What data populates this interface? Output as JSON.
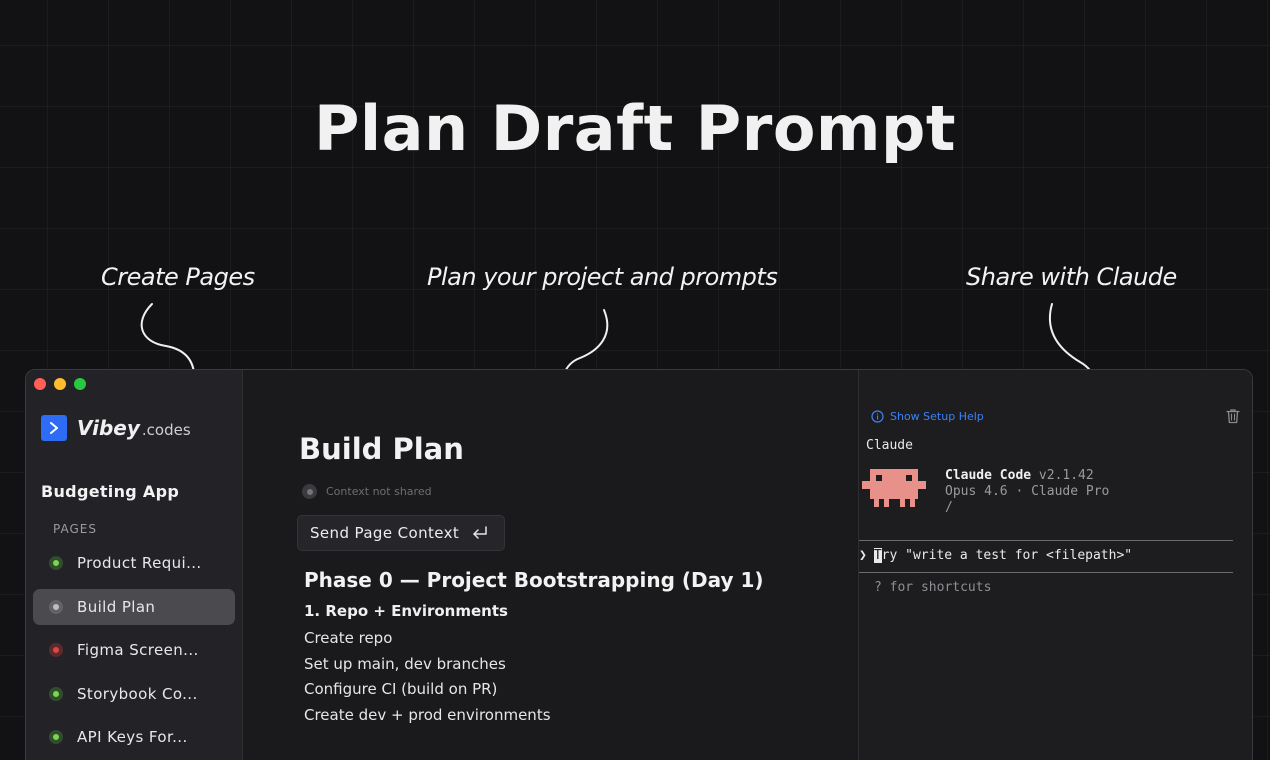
{
  "headline": "Plan Draft Prompt",
  "annotations": {
    "left": "Create Pages",
    "center": "Plan your project and prompts",
    "right": "Share with Claude"
  },
  "colors": {
    "accent_blue": "#2f6cf6",
    "link_blue": "#3b82f6",
    "status_green": "#7cd64a",
    "status_red": "#e04545",
    "status_gray": "#bdbdbd",
    "mascot": "#e8908a"
  },
  "sidebar": {
    "logo_name": "Vibey",
    "logo_suffix": ".codes",
    "project_title": "Budgeting App",
    "pages_label": "PAGES",
    "items": [
      {
        "label": "Product Requi...",
        "status": "green",
        "active": false
      },
      {
        "label": "Build Plan",
        "status": "gray",
        "active": true
      },
      {
        "label": "Figma Screen...",
        "status": "red",
        "active": false
      },
      {
        "label": "Storybook Co...",
        "status": "green",
        "active": false
      },
      {
        "label": "API Keys For...",
        "status": "green",
        "active": false
      }
    ]
  },
  "main": {
    "title": "Build Plan",
    "context_status": "Context not shared",
    "send_button": "Send Page Context",
    "phase_title": "Phase 0 — Project Bootstrapping (Day 1)",
    "section_title": "1. Repo + Environments",
    "tasks": [
      "Create repo",
      "Set up main, dev branches",
      "Configure CI (build on PR)",
      "Create dev + prod environments"
    ]
  },
  "terminal": {
    "setup_help": "Show Setup Help",
    "label": "Claude",
    "app_name": "Claude Code",
    "version": "v2.1.42",
    "model_line": "Opus 4.6 · Claude Pro",
    "path": "/",
    "prompt_symbol": "❯",
    "prompt_first_char": "T",
    "prompt_text": "ry \"write a test for <filepath>\"",
    "shortcuts_hint": "? for shortcuts"
  }
}
